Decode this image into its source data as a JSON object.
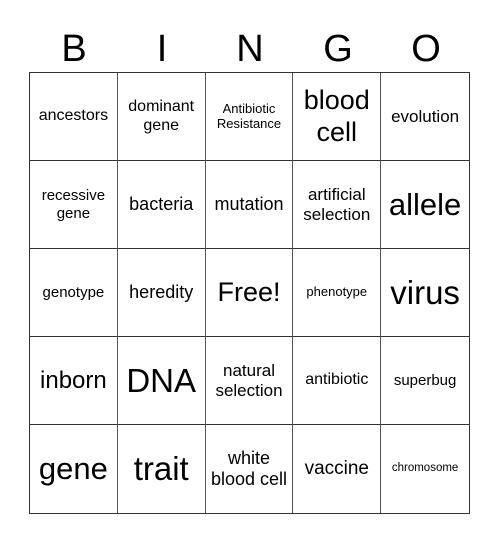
{
  "header": [
    "B",
    "I",
    "N",
    "G",
    "O"
  ],
  "cells": [
    {
      "text": "ancestors",
      "size": "s16"
    },
    {
      "text": "dominant gene",
      "size": "s16"
    },
    {
      "text": "Antibiotic Resistance",
      "size": "s12"
    },
    {
      "text": "blood cell",
      "size": "s26"
    },
    {
      "text": "evolution",
      "size": "s17"
    },
    {
      "text": "recessive gene",
      "size": "s15"
    },
    {
      "text": "bacteria",
      "size": "s18"
    },
    {
      "text": "mutation",
      "size": "s18"
    },
    {
      "text": "artificial selection",
      "size": "s17"
    },
    {
      "text": "allele",
      "size": "s30"
    },
    {
      "text": "genotype",
      "size": "s15"
    },
    {
      "text": "heredity",
      "size": "s18"
    },
    {
      "text": "Free!",
      "size": "s26"
    },
    {
      "text": "phenotype",
      "size": "s13"
    },
    {
      "text": "virus",
      "size": "s32"
    },
    {
      "text": "inborn",
      "size": "s24"
    },
    {
      "text": "DNA",
      "size": "s32"
    },
    {
      "text": "natural selection",
      "size": "s17"
    },
    {
      "text": "antibiotic",
      "size": "s16"
    },
    {
      "text": "superbug",
      "size": "s15"
    },
    {
      "text": "gene",
      "size": "s30"
    },
    {
      "text": "trait",
      "size": "s32"
    },
    {
      "text": "white blood cell",
      "size": "s18"
    },
    {
      "text": "vaccine",
      "size": "s19"
    },
    {
      "text": "chromosome",
      "size": "s11"
    }
  ]
}
